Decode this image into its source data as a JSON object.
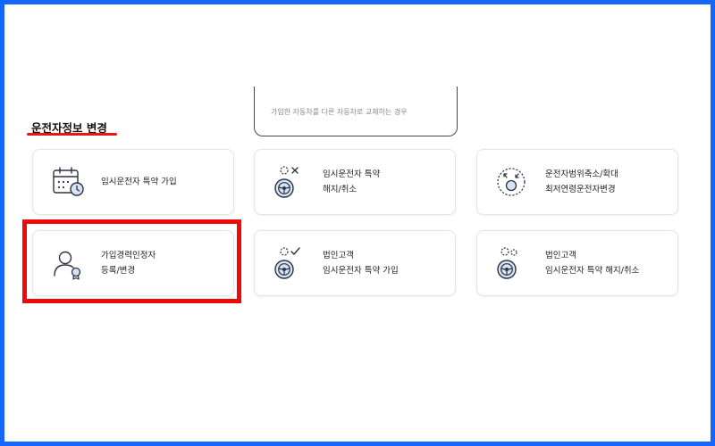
{
  "section": {
    "title": "운전자정보 변경"
  },
  "partial_card": {
    "text": "가입한 자동차를 다른 자동차로 교체하는 경우"
  },
  "cards": [
    {
      "line1": "임시운전자 특약 가입",
      "line2": "",
      "icon": "calendar-clock-icon"
    },
    {
      "line1": "임시운전자 특약",
      "line2": "해지/취소",
      "icon": "steering-wheel-remove-icon"
    },
    {
      "line1": "운전자범위축소/확대",
      "line2": "최저연령운전자변경",
      "icon": "driver-range-icon"
    },
    {
      "line1": "가입경력인정자",
      "line2": "등록/변경",
      "icon": "user-certificate-icon"
    },
    {
      "line1": "법인고객",
      "line2": "임시운전자 특약 가입",
      "icon": "steering-wheel-check-icon"
    },
    {
      "line1": "법인고객",
      "line2": "임시운전자 특약 해지/취소",
      "icon": "steering-wheel-dots-icon"
    }
  ],
  "colors": {
    "frame_border": "#1565ff",
    "highlight": "#ee0a0a",
    "title_underline": "#e8151b",
    "icon_fill": "#d7e3f5",
    "icon_stroke": "#2b3242"
  }
}
